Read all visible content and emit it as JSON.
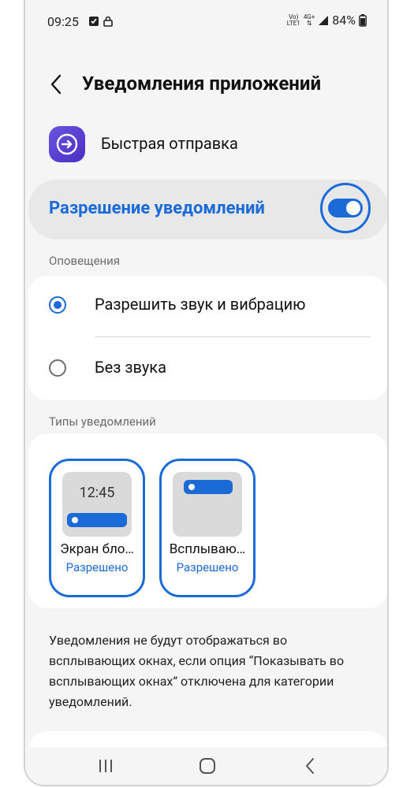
{
  "status_bar": {
    "time": "09:25",
    "left_icons": [
      "checkbox-notification-icon",
      "lock-icon"
    ],
    "volte_top": "Vo)",
    "volte_bottom": "LTE1",
    "network_top": "4G+",
    "battery": "84%"
  },
  "header": {
    "title": "Уведомления приложений"
  },
  "app": {
    "name": "Быстрая отправка"
  },
  "permission": {
    "label": "Разрешение уведомлений",
    "enabled": true
  },
  "alerts": {
    "section_title": "Оповещения",
    "options": [
      {
        "label": "Разрешить звук и вибрацию",
        "selected": true
      },
      {
        "label": "Без звука",
        "selected": false
      }
    ]
  },
  "notification_types": {
    "section_title": "Типы уведомлений",
    "items": [
      {
        "name": "Экран бло…",
        "status": "Разрешено",
        "preview_time": "12:45"
      },
      {
        "name": "Всплываю…",
        "status": "Разрешено"
      }
    ]
  },
  "note": "Уведомления не будут отображаться во всплывающих окнах, если опция “Показывать во всплывающих окнах” отключена для категории уведомлений.",
  "colors": {
    "accent": "#1a6ad8",
    "background": "#f5f5f5",
    "card": "#ffffff"
  }
}
